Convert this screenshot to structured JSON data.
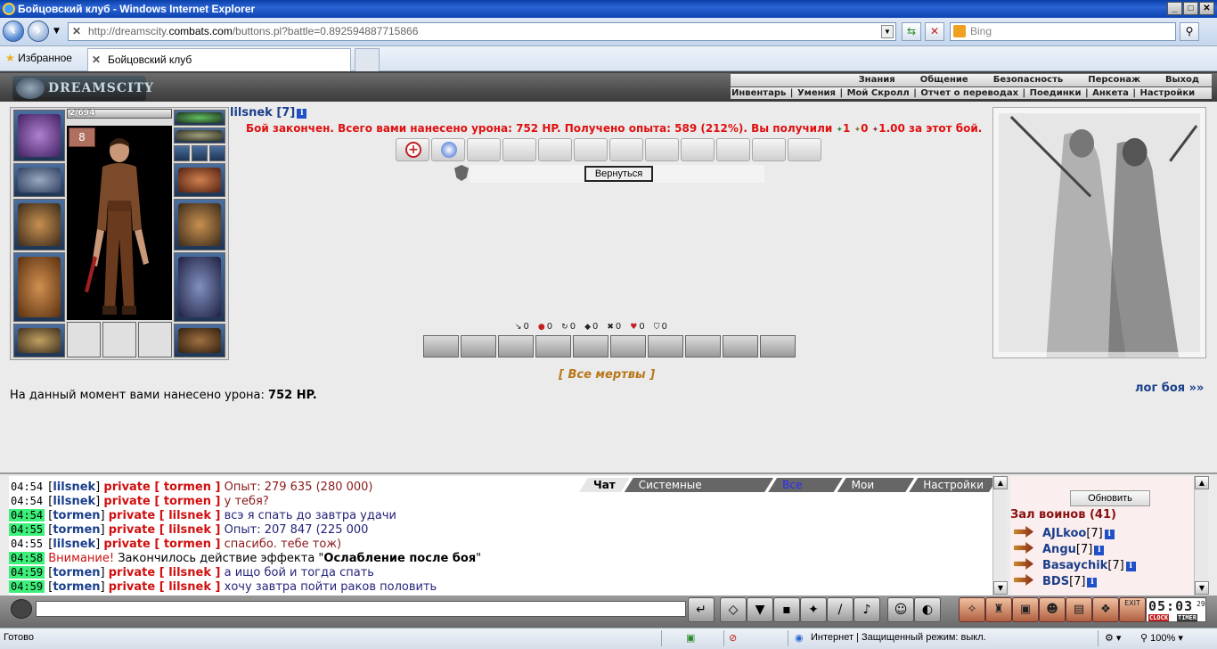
{
  "window": {
    "title": "Бойцовский клуб - Windows Internet Explorer",
    "minimize": "_",
    "maximize": "□",
    "close": "✕"
  },
  "address_bar": {
    "url_prefix": "http://dreamscity.",
    "url_host": "combats.com",
    "url_suffix": "/buttons.pl?battle=0.892594887715866",
    "search_placeholder": "Bing"
  },
  "favorites_bar": {
    "favorites_label": "Избранное",
    "tab_title": "Бойцовский клуб"
  },
  "game_header": {
    "logo_text": "DREAMSCITY",
    "top_menu": [
      "Знания",
      "Общение",
      "Безопасность",
      "Персонаж",
      "Выход"
    ],
    "sub_menu": [
      "Инвентарь",
      "Умения",
      "Мой Скролл",
      "Отчет о переводах",
      "Поединки",
      "Анкета",
      "Настройки"
    ]
  },
  "character": {
    "hp": "2/694",
    "name": "lilsnek",
    "level": "[7]"
  },
  "battle": {
    "result_message": "Бой закончен. Всего вами нанесено урона: 752 HP. Получено опыта: 589 (212%). Вы получили",
    "reward_1": "1",
    "reward_2": "0",
    "reward_3": "1.00",
    "result_suffix": "за этот бой.",
    "return_button": "Вернуться",
    "stats": [
      "0",
      "0",
      "0",
      "0",
      "0",
      "0",
      "0"
    ],
    "all_dead": "[ Все мертвы ]",
    "damage_prefix": "На данный момент вами нанесено урона:",
    "damage_value": "752 HP.",
    "log_link": "лог боя »»"
  },
  "chat": {
    "tabs": [
      "Чат",
      "Системные сообщения",
      "Все логи",
      "Мои логи",
      "Настройки"
    ],
    "messages": [
      {
        "time": "04:54",
        "nick": "lilsnek",
        "private": "private [ tormen ]",
        "text": "Опыт: 279 635 (280 000)"
      },
      {
        "time": "04:54",
        "nick": "lilsnek",
        "private": "private [ tormen ]",
        "text": "у тебя?"
      },
      {
        "time": "04:54",
        "nick": "tormen",
        "private": "private [ lilsnek ]",
        "text": "всэ я спать до завтра удачи"
      },
      {
        "time": "04:55",
        "nick": "tormen",
        "private": "private [ lilsnek ]",
        "text": "Опыт: 207 847 (225 000"
      },
      {
        "time": "04:55",
        "nick": "lilsnek",
        "private": "private [ tormen ]",
        "text": "спасибо. тебе тож)"
      },
      {
        "time": "04:58",
        "attention": "Внимание!",
        "text_a": " Закончилось действие эффекта \"",
        "effect": "Ослабление после боя",
        "text_b": "\""
      },
      {
        "time": "04:59",
        "nick": "tormen",
        "private": "private [ lilsnek ]",
        "text": "а ищо бой и тогда спать"
      },
      {
        "time": "04:59",
        "nick": "tormen",
        "private": "private [ lilsnek ]",
        "text": "хочу завтра пойти раков половить"
      }
    ]
  },
  "users": {
    "refresh_button": "Обновить",
    "hall_title": "Зал воинов (41)",
    "list": [
      {
        "name": "AJLkoo",
        "level": "[7]"
      },
      {
        "name": "Angu",
        "level": "[7]"
      },
      {
        "name": "Basaychik",
        "level": "[7]"
      },
      {
        "name": "BDS",
        "level": "[7]"
      }
    ]
  },
  "toolbar": {
    "clock_time": "05:03",
    "clock_seconds": "29",
    "clock_label": "CLOCK",
    "timer_label": "TIMER",
    "exit_label": "EXIT"
  },
  "status_bar": {
    "status": "Готово",
    "zone": "Интернет | Защищенный режим: выкл.",
    "zoom": "100%"
  }
}
